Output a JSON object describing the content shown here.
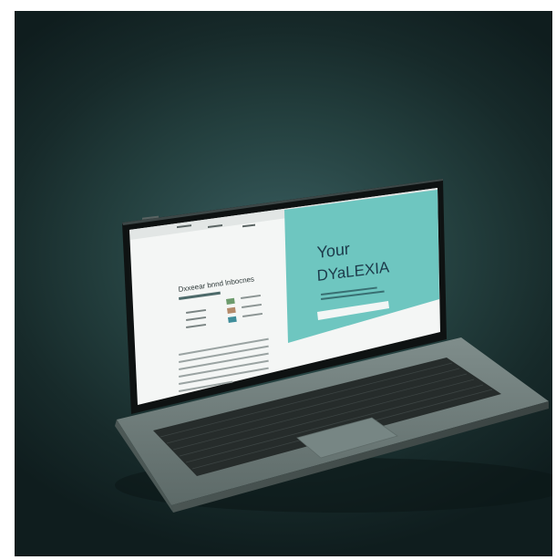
{
  "screen": {
    "hero": {
      "title_line1": "Your",
      "title_line2": "DYaLEXIA",
      "accent_color": "#6ec6c0"
    },
    "article": {
      "heading": "Dxxeear bnnd lnbocnes"
    }
  },
  "colors": {
    "background": "#1d3435",
    "laptop_body": "#6f7d7b",
    "keyboard": "#2a302f",
    "screen_bezel": "#0e1212",
    "page_bg": "#f4f6f5"
  }
}
